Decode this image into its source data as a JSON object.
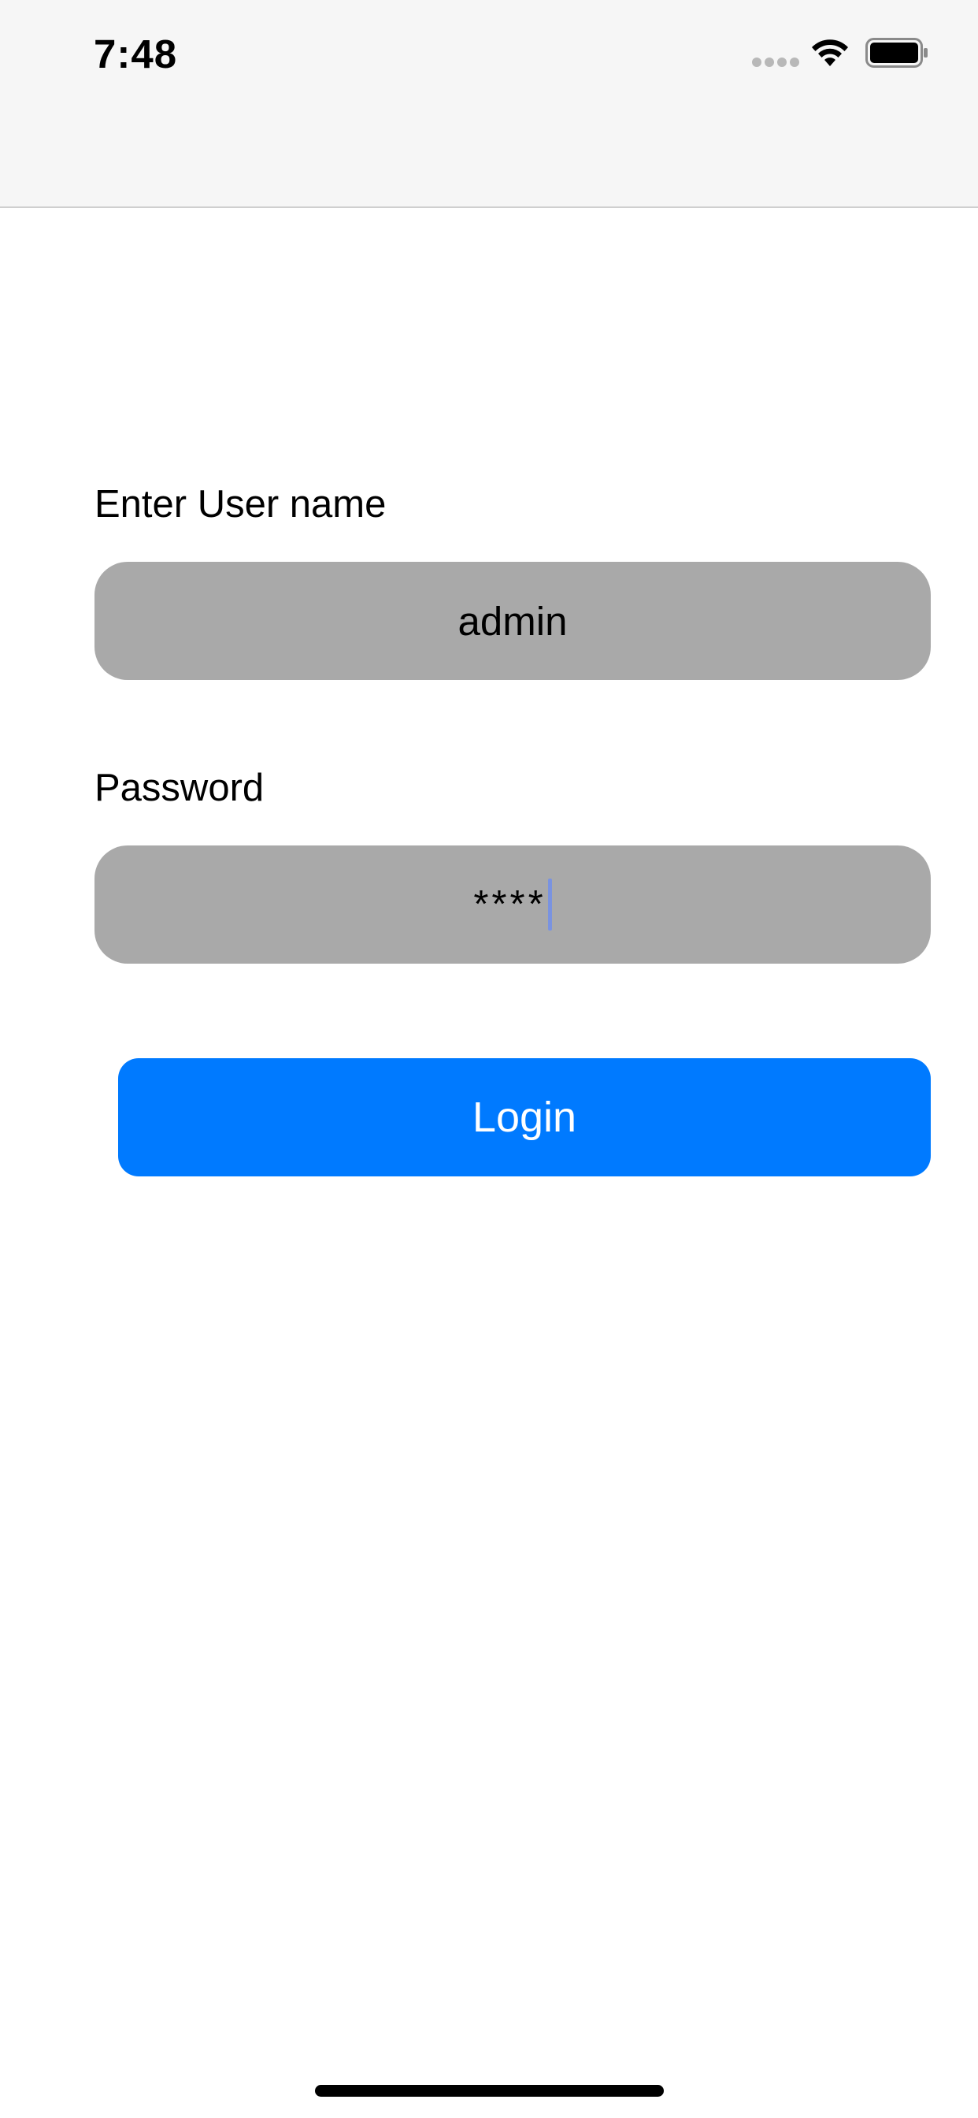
{
  "status_bar": {
    "time": "7:48",
    "icons": [
      "cellular-signal-icon",
      "wifi-icon",
      "battery-icon"
    ]
  },
  "login_form": {
    "username_label": "Enter User name",
    "username_value": "admin",
    "password_label": "Password",
    "password_value": "****",
    "login_button_label": "Login"
  },
  "colors": {
    "accent": "#007aff",
    "field_background": "#a9a9a9",
    "nav_background": "#f6f6f6",
    "caret": "#7a93e0"
  }
}
